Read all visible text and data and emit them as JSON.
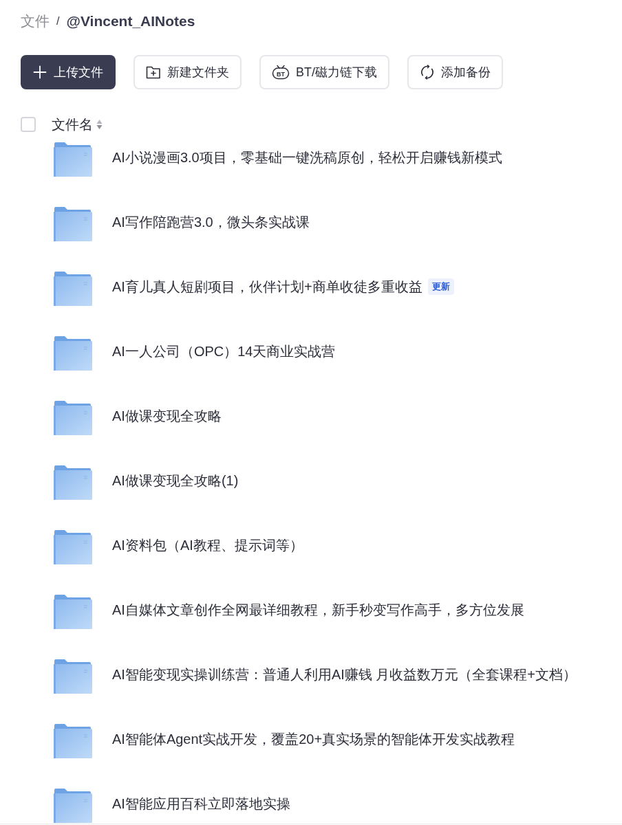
{
  "breadcrumb": {
    "separator": "/",
    "items": [
      {
        "label": "文件",
        "current": false
      },
      {
        "label": "@Vincent_AINotes",
        "current": true
      }
    ]
  },
  "toolbar": [
    {
      "label": "上传文件",
      "kind": "upload"
    },
    {
      "label": "新建文件夹",
      "kind": "new_folder"
    },
    {
      "label": "BT/磁力链下载",
      "kind": "bt",
      "icon_text": "BT"
    },
    {
      "label": "添加备份",
      "kind": "backup"
    }
  ],
  "file_list": {
    "select_all": {
      "checked": false
    },
    "column": "文件名",
    "rows": [
      {
        "name": "AI小说漫画3.0项目，零基础一键洗稿原创，轻松开启赚钱新模式"
      },
      {
        "name": "AI写作陪跑营3.0，微头条实战课"
      },
      {
        "name": "AI育儿真人短剧项目，伙伴计划+商单收徒多重收益",
        "badge": "更新"
      },
      {
        "name": "AI一人公司（OPC）14天商业实战营"
      },
      {
        "name": "AI做课变现全攻略"
      },
      {
        "name": "AI做课变现全攻略(1)"
      },
      {
        "name": "AI资料包（AI教程、提示词等）"
      },
      {
        "name": "AI自媒体文章创作全网最详细教程，新手秒变写作高手，多方位发展"
      },
      {
        "name": "AI智能变现实操训练营：普通人利用AI赚钱 月收益数万元（全套课程+文档）"
      },
      {
        "name": "AI智能体Agent实战开发，覆盖20+真实场景的智能体开发实战教程"
      },
      {
        "name": "AI智能应用百科立即落地实操"
      }
    ]
  }
}
